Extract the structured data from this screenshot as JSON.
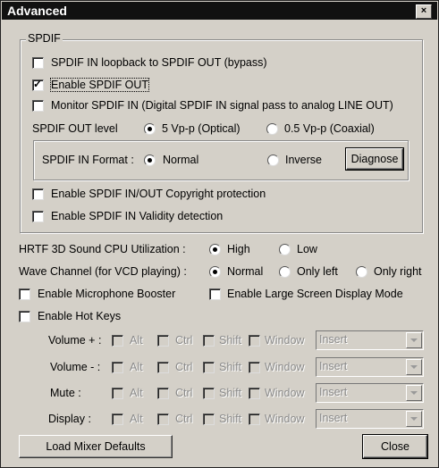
{
  "window": {
    "title": "Advanced",
    "close_glyph": "×"
  },
  "spdif": {
    "group_label": "SPDIF",
    "loopback": {
      "label": "SPDIF IN loopback to SPDIF OUT (bypass)",
      "checked": false
    },
    "enable_out": {
      "label": "Enable SPDIF OUT",
      "checked": true
    },
    "monitor": {
      "label": "Monitor SPDIF IN  (Digital SPDIF IN signal pass to analog LINE OUT)",
      "checked": false
    },
    "out_level": {
      "label": "SPDIF OUT level",
      "options": [
        "5 Vp-p (Optical)",
        "0.5 Vp-p (Coaxial)"
      ],
      "selected": "5 Vp-p (Optical)"
    },
    "in_format": {
      "label": "SPDIF IN Format :",
      "options": [
        "Normal",
        "Inverse"
      ],
      "selected": "Normal",
      "diagnose_label": "Diagnose"
    },
    "copyright": {
      "label": "Enable SPDIF IN/OUT Copyright protection",
      "checked": false
    },
    "validity": {
      "label": "Enable SPDIF IN Validity detection",
      "checked": false
    }
  },
  "hrtf": {
    "label": "HRTF 3D Sound CPU Utilization :",
    "options": [
      "High",
      "Low"
    ],
    "selected": "High"
  },
  "wave": {
    "label": "Wave Channel (for VCD playing) :",
    "options": [
      "Normal",
      "Only left",
      "Only right"
    ],
    "selected": "Normal"
  },
  "mic_booster": {
    "label": "Enable Microphone Booster",
    "checked": false
  },
  "large_screen": {
    "label": "Enable Large Screen Display Mode",
    "checked": false
  },
  "hot_keys": {
    "label": "Enable Hot Keys",
    "checked": false,
    "modifiers": [
      "Alt",
      "Ctrl",
      "Shift",
      "Window"
    ],
    "rows": [
      {
        "label": "Volume + :",
        "key": "Insert"
      },
      {
        "label": "Volume - :",
        "key": "Insert"
      },
      {
        "label": "Mute :",
        "key": "Insert"
      },
      {
        "label": "Display :",
        "key": "Insert"
      }
    ]
  },
  "buttons": {
    "load_defaults": "Load Mixer Defaults",
    "close": "Close"
  },
  "colors": {
    "face": "#d4d0c8",
    "titlebar": "#111111",
    "disabled_text": "#8a8a8a"
  }
}
